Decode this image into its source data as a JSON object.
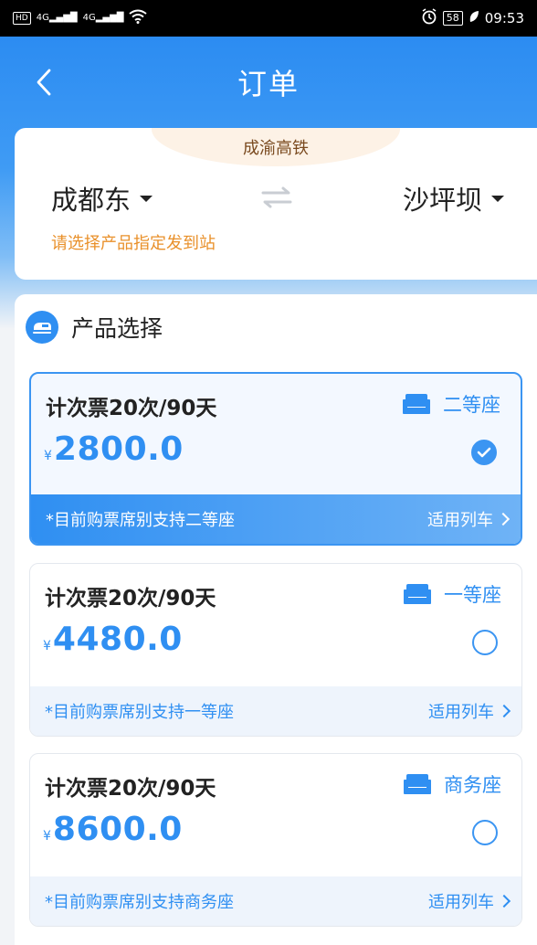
{
  "status_bar": {
    "left_hd": "HD",
    "left_net1": "4G",
    "left_net2": "4G",
    "battery": "58",
    "time": "09:53"
  },
  "nav": {
    "title": "订单"
  },
  "route": {
    "line_name": "成渝高铁",
    "from": "成都东",
    "to": "沙坪坝",
    "hint": "请选择产品指定发到站"
  },
  "products_section": {
    "title": "产品选择",
    "items": [
      {
        "name": "计次票20次/90天",
        "seat": "二等座",
        "currency": "¥",
        "price": "2800.0",
        "note": "*目前购票席别支持二等座",
        "link": "适用列车",
        "selected": true
      },
      {
        "name": "计次票20次/90天",
        "seat": "一等座",
        "currency": "¥",
        "price": "4480.0",
        "note": "*目前购票席别支持一等座",
        "link": "适用列车",
        "selected": false
      },
      {
        "name": "计次票20次/90天",
        "seat": "商务座",
        "currency": "¥",
        "price": "8600.0",
        "note": "*目前购票席别支持商务座",
        "link": "适用列车",
        "selected": false
      }
    ]
  },
  "colors": {
    "accent": "#2f8ff2",
    "hint": "#e9902a"
  }
}
